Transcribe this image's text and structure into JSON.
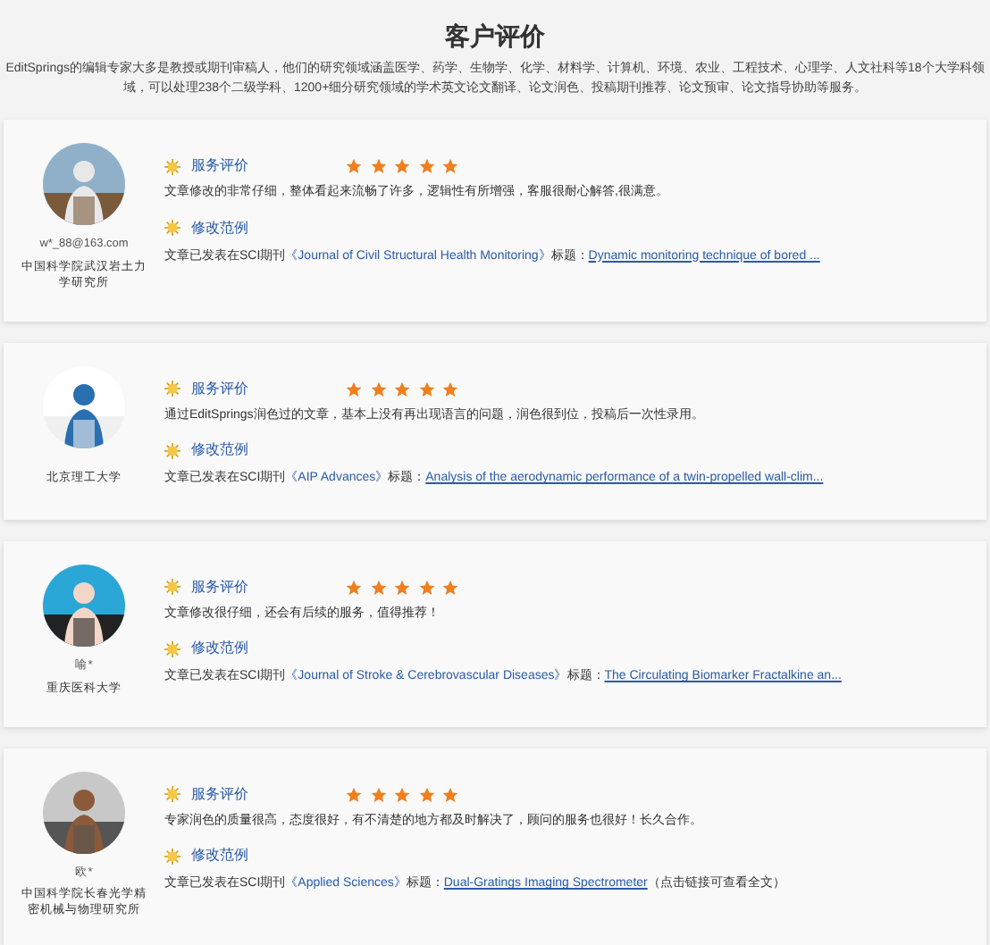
{
  "header": {
    "title": "客户评价",
    "description": "EditSprings的编辑专家大多是教授或期刊审稿人，他们的研究领域涵盖医学、药学、生物学、化学、材料学、计算机、环境、农业、工程技术、心理学、人文社科等18个大学科领域，可以处理238个二级学科、1200+细分研究领域的学术英文论文翻译、论文润色、投稿期刊推荐、论文预审、论文指导协助等服务。"
  },
  "reviews": [
    {
      "user": "w*_88@163.com",
      "org": "中国科学院武汉岩土力学研究所",
      "rating_label": "服务评价",
      "stars": 5,
      "comment": "文章修改的非常仔细，整体看起来流畅了许多，逻辑性有所增强，客服很耐心解答,很满意。",
      "example_label": "修改范例",
      "pub_prefix": "文章已发表在SCI期刊",
      "journal": "《Journal of Civil Structural Health Monitoring》",
      "title_label": "标题：",
      "paper": "Dynamic monitoring technique of bored ..."
    },
    {
      "org": "北京理工大学",
      "rating_label": "服务评价",
      "stars": 5,
      "comment": "通过EditSprings润色过的文章，基本上没有再出现语言的问题，润色很到位，投稿后一次性录用。",
      "example_label": "修改范例",
      "pub_prefix": "文章已发表在SCI期刊",
      "journal": "《AIP Advances》",
      "title_label": "标题：",
      "paper": "Analysis of the aerodynamic performance of a twin-propelled wall-clim..."
    },
    {
      "user": "喻*",
      "org": "重庆医科大学",
      "rating_label": "服务评价",
      "stars": 5,
      "comment": "文章修改很仔细，还会有后续的服务，值得推荐！",
      "example_label": "修改范例",
      "pub_prefix": "文章已发表在SCI期刊",
      "journal": "《Journal of Stroke & Cerebrovascular Diseases》",
      "title_label": "标题：",
      "paper": "The Circulating Biomarker Fractalkine an..."
    },
    {
      "user": "欧*",
      "org": "中国科学院长春光学精密机械与物理研究所",
      "rating_label": "服务评价",
      "stars": 5,
      "comment": "专家润色的质量很高，态度很好，有不清楚的地方都及时解决了，顾问的服务也很好！长久合作。",
      "example_label": "修改范例",
      "pub_prefix": "文章已发表在SCI期刊",
      "journal": "《Applied Sciences》",
      "title_label": "标题：",
      "paper": "Dual-Gratings Imaging Spectrometer",
      "note": "（点击链接可查看全文）"
    }
  ]
}
